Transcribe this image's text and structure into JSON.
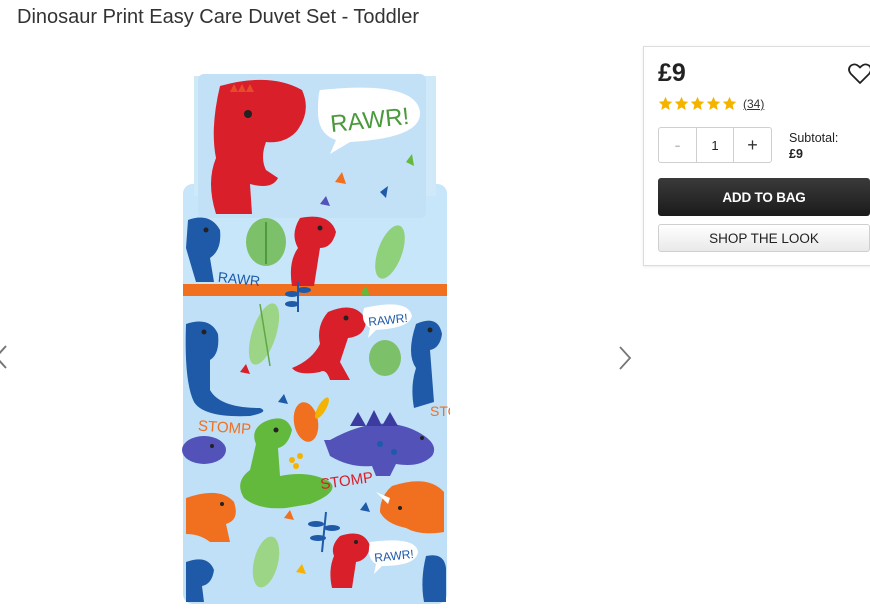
{
  "product": {
    "title": "Dinosaur Print Easy Care Duvet Set - Toddler"
  },
  "gallery": {
    "pillow_text": "RAWR!",
    "duvet_texts": {
      "rawr_1": "RAWR!",
      "rawr_2": "RAWR!",
      "stomp_1": "STOMP",
      "stomp_2": "STOMP",
      "stomp_3": "STO",
      "rawr_3": "RAWR"
    }
  },
  "buy_box": {
    "price": "£9",
    "rating": {
      "stars": 5,
      "count_text": "(34)"
    },
    "quantity": {
      "minus_label": "-",
      "value": "1",
      "plus_label": "+"
    },
    "subtotal": {
      "label": "Subtotal:",
      "value": "£9"
    },
    "add_to_bag_label": "ADD TO BAG",
    "shop_the_look_label": "SHOP THE LOOK"
  },
  "colors": {
    "star": "#f5b301",
    "add_to_bag_bg": "#1f1f1f",
    "duvet_bg": "#bfe0f7",
    "dino_red": "#d81f2a",
    "dino_blue": "#1e5aa8",
    "dino_orange": "#f07020",
    "dino_green": "#62b93c",
    "dino_purple": "#5252b8"
  },
  "icons": {
    "heart": "heart-icon",
    "star": "star-icon",
    "next": "chevron-right-icon",
    "prev": "chevron-left-icon"
  }
}
